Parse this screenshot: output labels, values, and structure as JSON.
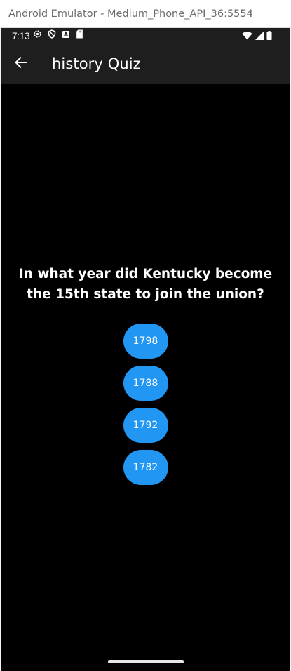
{
  "window": {
    "title": "Android Emulator - Medium_Phone_API_36:5554"
  },
  "status_bar": {
    "time": "7:13",
    "left_icons": [
      "settings-icon",
      "shield-icon",
      "a-badge-icon",
      "sd-card-icon"
    ],
    "right_icons": [
      "wifi-icon",
      "signal-icon",
      "battery-icon"
    ]
  },
  "app_bar": {
    "title": "history Quiz",
    "back_icon": "arrow-left-icon"
  },
  "quiz": {
    "question": "In what year did Kentucky become the 15th state to join the union?",
    "answers": [
      "1798",
      "1788",
      "1792",
      "1782"
    ]
  },
  "colors": {
    "background": "#000000",
    "app_bar": "#1e1e1e",
    "answer_button": "#2196f3",
    "text": "#ffffff"
  }
}
